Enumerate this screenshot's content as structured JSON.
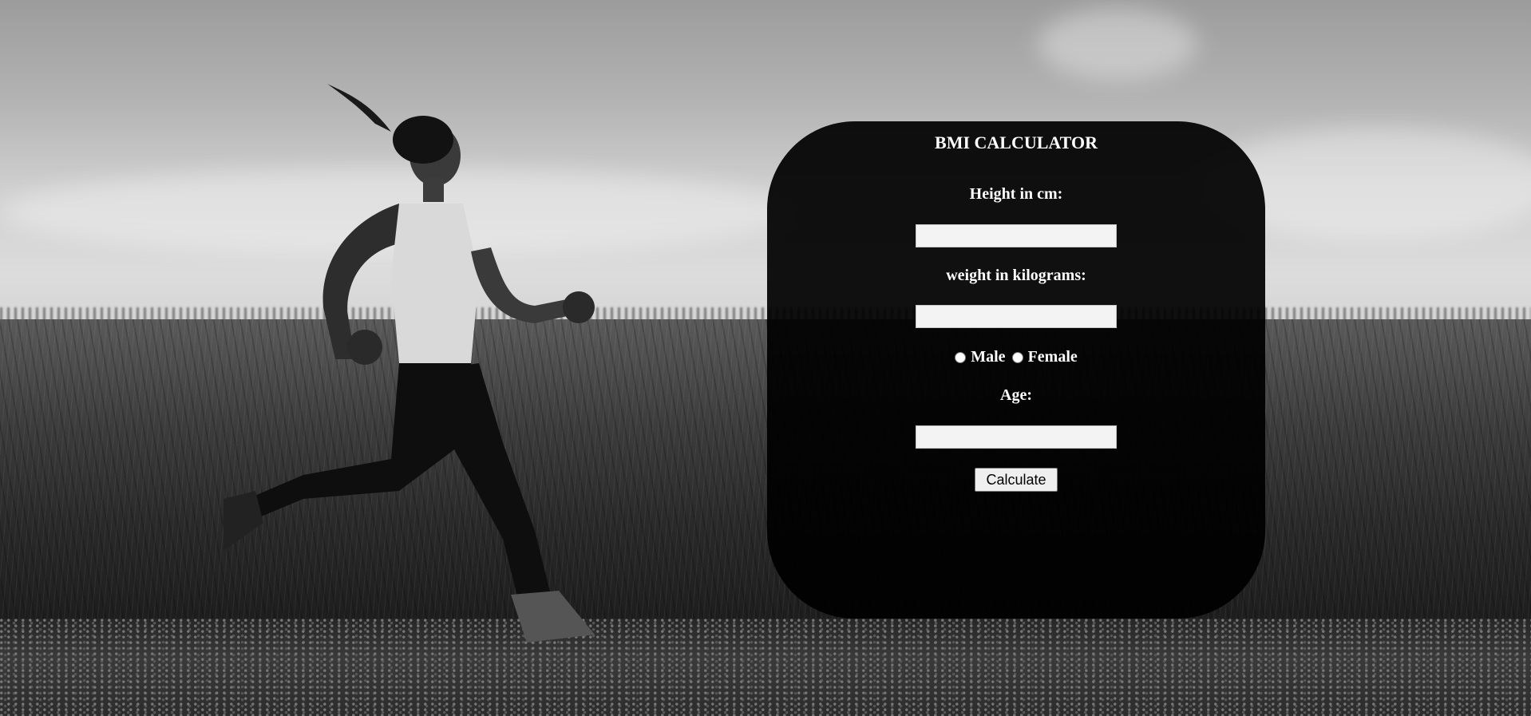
{
  "form": {
    "title": "BMI CALCULATOR",
    "height_label": "Height in cm:",
    "height_value": "",
    "weight_label": "weight in kilograms:",
    "weight_value": "",
    "gender_options": [
      "Male",
      "Female"
    ],
    "gender_selected": null,
    "age_label": "Age:",
    "age_value": "",
    "calculate_label": "Calculate"
  },
  "colors": {
    "card_background": "#000000",
    "text": "#ffffff",
    "input_background": "#f3f3f3"
  },
  "background": {
    "subject": "runner-in-grass-field-photo"
  }
}
